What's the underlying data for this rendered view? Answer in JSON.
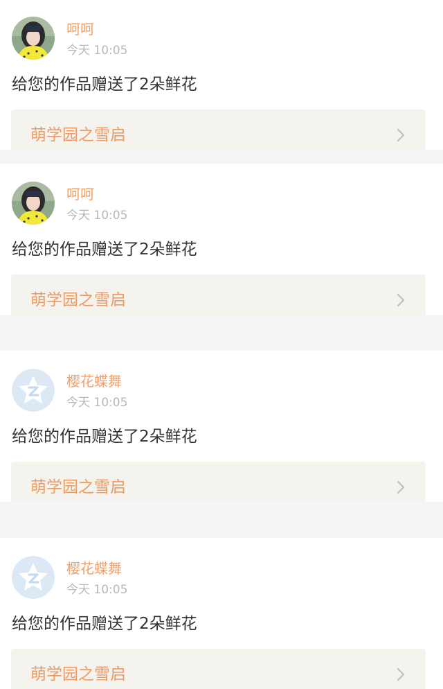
{
  "notifications": [
    {
      "user": "呵呵",
      "avatar": "photo-avatar",
      "time": "今天 10:05",
      "message": "给您的作品赠送了2朵鲜花",
      "work_title": "萌学园之雪启",
      "chevron_icon": "chevron-right-icon"
    },
    {
      "user": "呵呵",
      "avatar": "photo-avatar",
      "time": "今天 10:05",
      "message": "给您的作品赠送了2朵鲜花",
      "work_title": "萌学园之雪启",
      "chevron_icon": "chevron-right-icon"
    },
    {
      "user": "樱花蝶舞",
      "avatar": "default-star-avatar",
      "time": "今天 10:05",
      "message": "给您的作品赠送了2朵鲜花",
      "work_title": "萌学园之雪启",
      "chevron_icon": "chevron-right-icon"
    },
    {
      "user": "樱花蝶舞",
      "avatar": "default-star-avatar",
      "time": "今天 10:05",
      "message": "给您的作品赠送了2朵鲜花",
      "work_title": "萌学园之雪启",
      "chevron_icon": "chevron-right-icon"
    }
  ],
  "colors": {
    "username": "#f0a06a",
    "work_title": "#ee9a63",
    "timestamp": "#b8b8b8",
    "message": "#333333",
    "link_background": "#f4f3ee",
    "page_background": "#f5f5f5"
  }
}
